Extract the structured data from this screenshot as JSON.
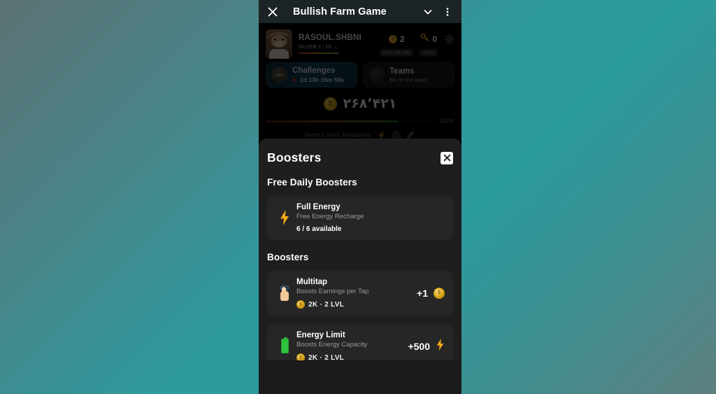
{
  "appbar": {
    "close_icon": "close-icon",
    "title": "Bullish Farm Game",
    "collapse_icon": "chevron-down-icon",
    "menu_icon": "more-vertical-icon"
  },
  "game": {
    "profile": {
      "avatar": "bull-avatar",
      "username": "RASOUL.SHBNI",
      "rank": "SILVER 2 / 10",
      "rank_chevrons": "»"
    },
    "stats": [
      {
        "icon": "coin-icon",
        "value": "2",
        "label": "Earn per tap"
      },
      {
        "icon": "key-icon",
        "value": "0",
        "label": "Keys"
      }
    ],
    "settings_icon": "gear-icon",
    "cards": [
      {
        "icon": "earth-badge-icon",
        "title": "Challenges",
        "timer": "1d 13h 16m 58s",
        "flag_icon": "flag-icon"
      },
      {
        "icon": "globe-icon",
        "title": "Teams",
        "subtitle": "Be on the team"
      }
    ],
    "balance": {
      "coin_icon": "coin-icon",
      "amount": "۲۶۸٬۴۲۱",
      "level_max": "300K"
    },
    "next_level": {
      "label": "Next Level Rewards",
      "reward_icons": [
        "bolt-icon",
        "coin-icon",
        "rocket-icon"
      ]
    }
  },
  "sheet": {
    "title": "Boosters",
    "close_icon": "close-icon",
    "free_section_title": "Free Daily Boosters",
    "free_boosters": [
      {
        "icon": "lightning-bolt-icon",
        "name": "Full Energy",
        "desc": "Free Energy Recharge",
        "meta": "6 / 6 available"
      }
    ],
    "boosters_section_title": "Boosters",
    "boosters": [
      {
        "icon": "tap-hand-icon",
        "name": "Multitap",
        "desc": "Boosts Earnings per Tap",
        "cost": "2K  ·  2 LVL",
        "cost_icon": "coin-icon",
        "gain": "+1",
        "gain_icon": "coin-icon"
      },
      {
        "icon": "battery-icon",
        "name": "Energy Limit",
        "desc": "Boosts Energy Capacity",
        "cost": "2K  ·  2 LVL",
        "cost_icon": "coin-icon",
        "gain": "+500",
        "gain_icon": "lightning-bolt-icon"
      }
    ]
  },
  "colors": {
    "page_bg_start": "#5c7274",
    "page_bg_mid": "#2e9a9e",
    "sheet_bg": "#1e1e1e",
    "card_bg": "#262626",
    "accent_gold": "#d9a313",
    "accent_bolt": "#f0a818",
    "accent_green": "#2fc23c",
    "appbar_bg": "#1c2326"
  }
}
